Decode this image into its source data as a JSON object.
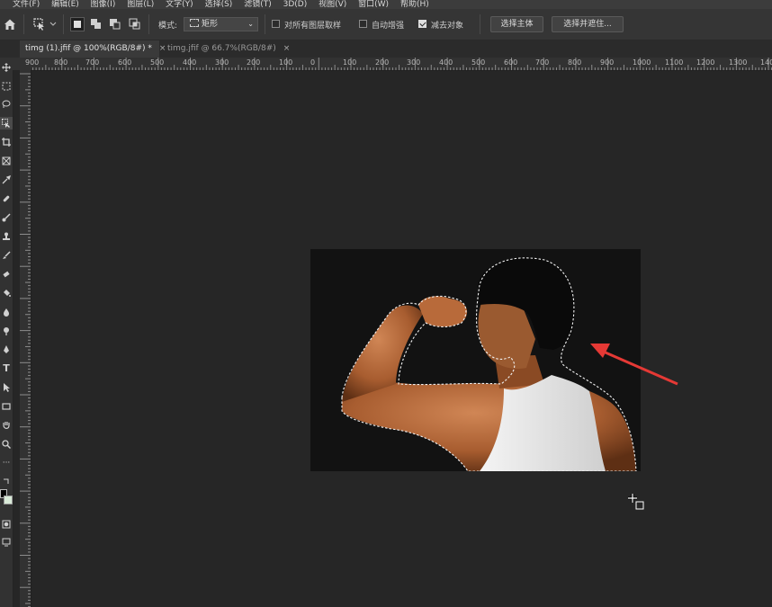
{
  "menu": [
    "文件(F)",
    "编辑(E)",
    "图像(I)",
    "图层(L)",
    "文字(Y)",
    "选择(S)",
    "滤镜(T)",
    "3D(D)",
    "视图(V)",
    "窗口(W)",
    "帮助(H)"
  ],
  "options": {
    "mode_label": "模式:",
    "mode_value": "矩形",
    "sample_all_layers": {
      "label": "对所有图层取样",
      "checked": false
    },
    "auto_enhance": {
      "label": "自动增强",
      "checked": false
    },
    "subtract_object": {
      "label": "减去对象",
      "checked": true
    },
    "select_subject_button": "选择主体",
    "select_and_mask_button": "选择并遮住..."
  },
  "tabs": [
    {
      "label": "timg (1).jfif @ 100%(RGB/8#) *",
      "active": true
    },
    {
      "label": "timg.jfif @ 66.7%(RGB/8#)",
      "active": false
    }
  ],
  "ruler": {
    "h_labels": [
      "900",
      "800",
      "700",
      "600",
      "500",
      "400",
      "300",
      "200",
      "100",
      "0",
      "100",
      "200",
      "300",
      "400",
      "500",
      "600",
      "700",
      "800",
      "900",
      "1000",
      "1100",
      "1200",
      "1300",
      "140"
    ]
  },
  "icons": {
    "home": "home-icon",
    "tool_preset": "object-selection-tool-icon",
    "cursor": "crosshair-add-cursor-icon"
  },
  "colors": {
    "foreground": "#000000",
    "background": "#d9ead8",
    "annotation_arrow": "#e53935"
  }
}
